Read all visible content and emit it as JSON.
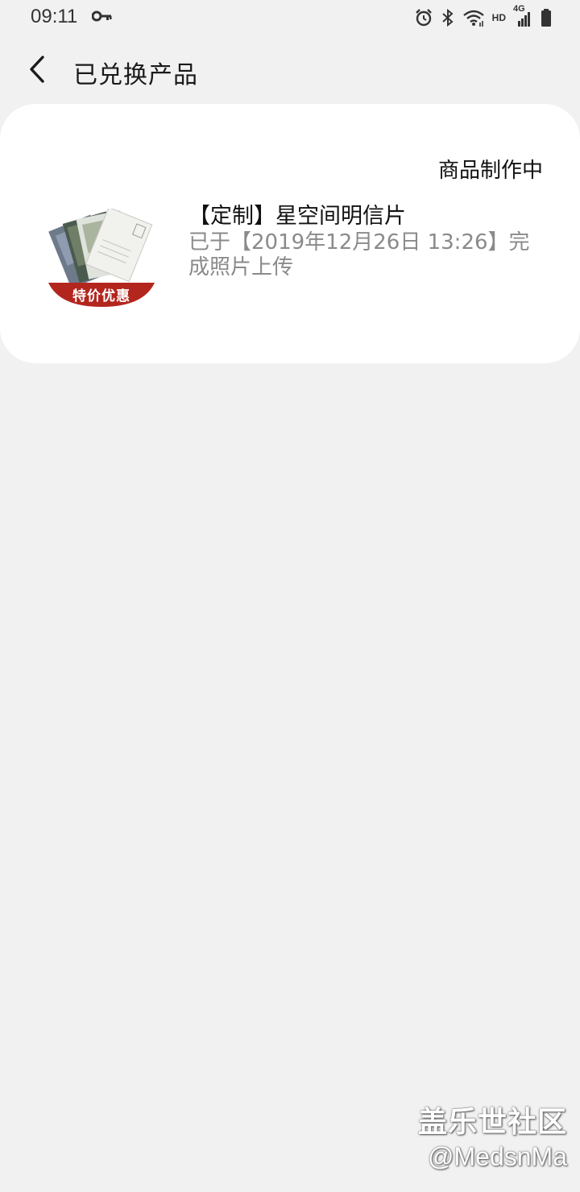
{
  "status_bar": {
    "time": "09:11",
    "network_label": "HD",
    "signal_label": "4G",
    "icons": [
      "vpn-key-icon",
      "alarm-icon",
      "bluetooth-icon",
      "wifi-icon",
      "signal-icon",
      "battery-icon"
    ]
  },
  "header": {
    "title": "已兑换产品",
    "back_icon": "chevron-left-icon"
  },
  "order": {
    "status": "商品制作中",
    "product_name": "【定制】星空间明信片",
    "description": "已于【2019年12月26日 13:26】完成照片上传",
    "thumbnail_badge": "特价优惠"
  },
  "watermark": {
    "title": "盖乐世社区",
    "handle": "@MedsnMa"
  },
  "colors": {
    "background": "#f1f1f1",
    "card": "#ffffff",
    "badge": "#b3261e",
    "secondary_text": "#8a8a8a"
  }
}
